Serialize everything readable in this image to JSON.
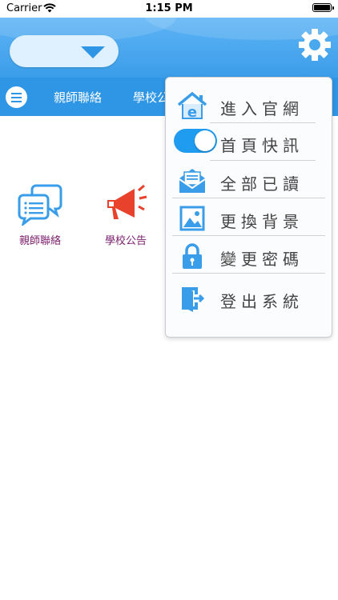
{
  "status": {
    "carrier": "Carrier",
    "time": "1:15 PM"
  },
  "header": {
    "dropdown_value": ""
  },
  "tabs": [
    {
      "label": "親師聯絡"
    },
    {
      "label": "學校公"
    }
  ],
  "apps": [
    {
      "label": "親師聯絡",
      "icon": "chat-bubbles-icon"
    },
    {
      "label": "學校公告",
      "icon": "megaphone-icon"
    }
  ],
  "settings_menu": {
    "items": [
      {
        "label": "進入官網",
        "icon": "home-e-icon"
      },
      {
        "label": "首頁快訊",
        "icon": "toggle-switch",
        "toggle_on": true
      },
      {
        "label": "全部已讀",
        "icon": "mail-read-icon"
      },
      {
        "label": "更換背景",
        "icon": "picture-icon"
      },
      {
        "label": "變更密碼",
        "icon": "lock-icon"
      },
      {
        "label": "登出系統",
        "icon": "logout-door-icon"
      }
    ]
  },
  "colors": {
    "primary": "#2f96e6",
    "header_top": "#5fb4f5",
    "app_label": "#7a1d6b",
    "toggle_on": "#1f9cf0"
  }
}
